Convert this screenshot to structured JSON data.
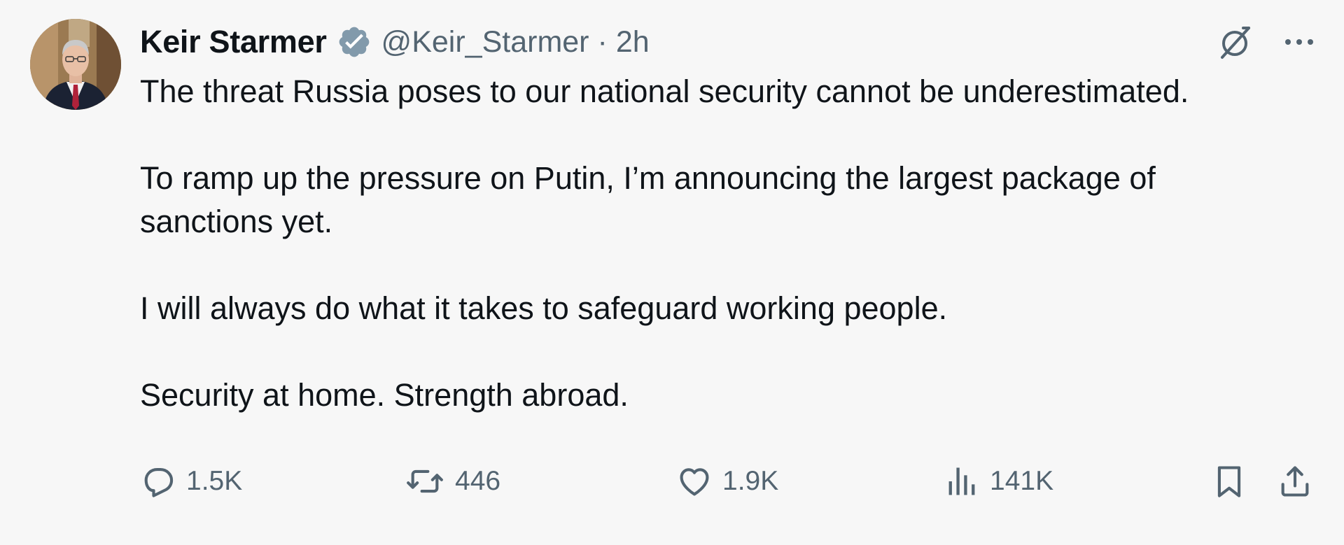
{
  "tweet": {
    "author_name": "Keir Starmer",
    "handle": "@Keir_Starmer",
    "separator": "·",
    "time": "2h",
    "paragraphs": [
      "The threat Russia poses to our national security cannot be underestimated.",
      "To ramp up the pressure on Putin, I’m announcing the largest package of sanctions yet.",
      "I will always do what it takes to safeguard working people.",
      "Security at home. Strength abroad."
    ],
    "metrics": {
      "replies": "1.5K",
      "reposts": "446",
      "likes": "1.9K",
      "views": "141K"
    }
  },
  "icons": {
    "verified": "verified-badge-icon",
    "grok": "grok-icon",
    "more": "more-icon",
    "reply": "reply-icon",
    "repost": "repost-icon",
    "like": "heart-icon",
    "views": "views-icon",
    "bookmark": "bookmark-icon",
    "share": "share-icon"
  },
  "colors": {
    "background": "#f7f7f7",
    "text_primary": "#0f1419",
    "text_secondary": "#536471",
    "verified_badge": "#829aab"
  }
}
